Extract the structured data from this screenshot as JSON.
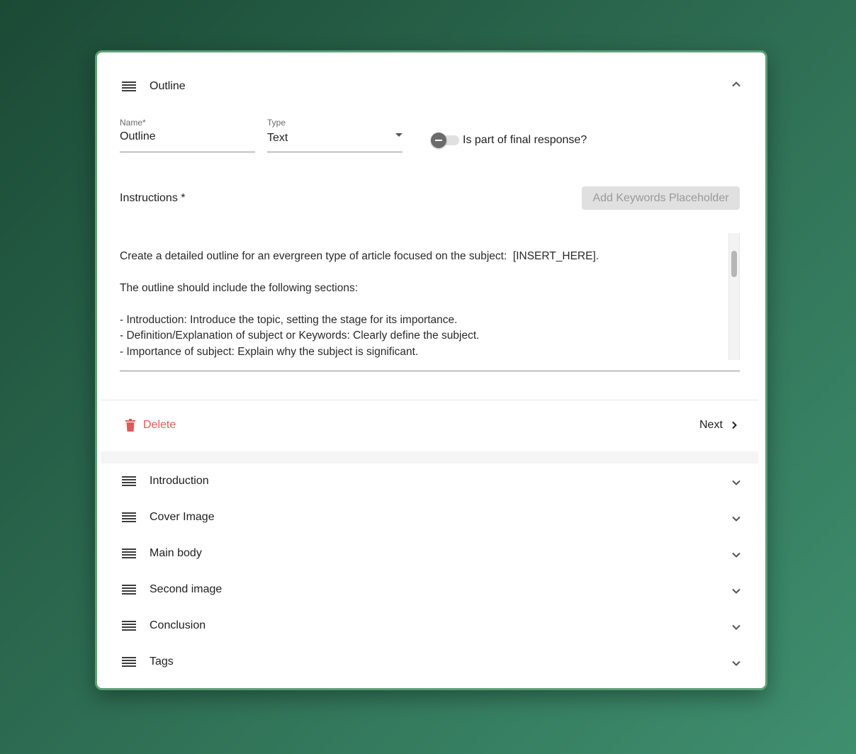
{
  "open_section": {
    "title": "Outline",
    "name_field": {
      "label": "Name*",
      "value": "Outline"
    },
    "type_field": {
      "label": "Type",
      "value": "Text"
    },
    "final_response_toggle": {
      "label": "Is part of final response?",
      "checked": false
    },
    "instructions": {
      "label": "Instructions *",
      "add_keywords_label": "Add Keywords Placeholder",
      "lines": [
        "",
        "Create a detailed outline for an evergreen type of article focused on the subject:  [INSERT_HERE].",
        "",
        "The outline should include the following sections:",
        "",
        "- Introduction: Introduce the topic, setting the stage for its importance.",
        "- Definition/Explanation of subject or Keywords: Clearly define the subject.",
        "- Importance of subject: Explain why the subject is significant."
      ]
    },
    "delete_label": "Delete",
    "next_label": "Next"
  },
  "sections": [
    {
      "title": "Introduction"
    },
    {
      "title": "Cover Image"
    },
    {
      "title": "Main body"
    },
    {
      "title": "Second image"
    },
    {
      "title": "Conclusion"
    },
    {
      "title": "Tags"
    }
  ],
  "colors": {
    "accent_border": "#5e9f76",
    "delete": "#e05a5a",
    "disabled_button": "#e0e0e0"
  },
  "icons": {
    "drag": "drag-handle-icon",
    "expand": "chevron-down-icon",
    "collapse": "chevron-up-icon",
    "delete": "trash-icon",
    "next": "chevron-right-icon",
    "dropdown": "caret-down-icon"
  }
}
